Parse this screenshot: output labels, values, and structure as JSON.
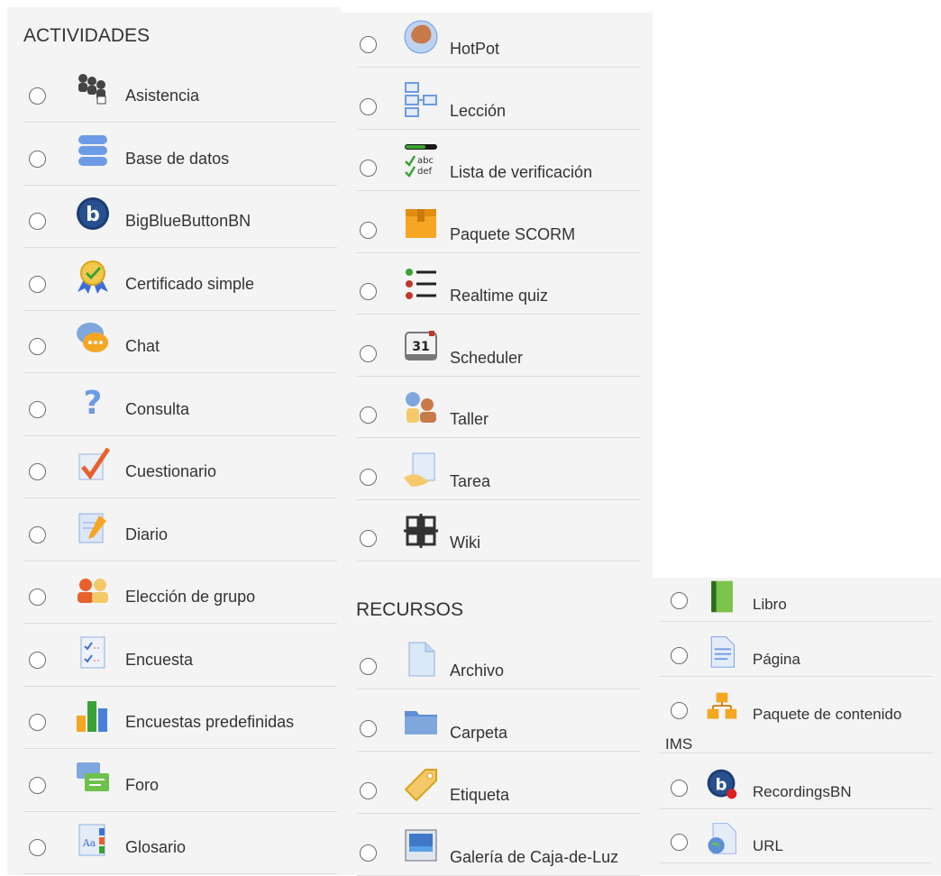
{
  "activities": {
    "heading": "ACTIVIDADES",
    "items": [
      {
        "label": "Asistencia",
        "icon": "attendance-icon"
      },
      {
        "label": "Base de datos",
        "icon": "database-icon"
      },
      {
        "label": "BigBlueButtonBN",
        "icon": "bigbluebutton-icon"
      },
      {
        "label": "Certificado simple",
        "icon": "certificate-icon"
      },
      {
        "label": "Chat",
        "icon": "chat-icon"
      },
      {
        "label": "Consulta",
        "icon": "question-icon"
      },
      {
        "label": "Cuestionario",
        "icon": "quiz-icon"
      },
      {
        "label": "Diario",
        "icon": "journal-icon"
      },
      {
        "label": "Elección de grupo",
        "icon": "group-choice-icon"
      },
      {
        "label": "Encuesta",
        "icon": "survey-icon"
      },
      {
        "label": "Encuestas predefinidas",
        "icon": "bar-chart-icon"
      },
      {
        "label": "Foro",
        "icon": "forum-icon"
      },
      {
        "label": "Glosario",
        "icon": "glossary-icon"
      }
    ],
    "more": [
      {
        "label": "HotPot",
        "icon": "hotpot-icon"
      },
      {
        "label": "Lección",
        "icon": "lesson-icon"
      },
      {
        "label": "Lista de verificación",
        "icon": "checklist-icon"
      },
      {
        "label": "Paquete SCORM",
        "icon": "scorm-package-icon"
      },
      {
        "label": "Realtime quiz",
        "icon": "realtime-quiz-icon"
      },
      {
        "label": "Scheduler",
        "icon": "calendar-icon"
      },
      {
        "label": "Taller",
        "icon": "workshop-icon"
      },
      {
        "label": "Tarea",
        "icon": "assignment-icon"
      },
      {
        "label": "Wiki",
        "icon": "wiki-icon"
      }
    ]
  },
  "resources": {
    "heading": "RECURSOS",
    "items": [
      {
        "label": "Archivo",
        "icon": "file-icon"
      },
      {
        "label": "Carpeta",
        "icon": "folder-icon"
      },
      {
        "label": "Etiqueta",
        "icon": "tag-icon"
      },
      {
        "label": "Galería de Caja-de-Luz",
        "icon": "lightbox-gallery-icon"
      }
    ],
    "more": [
      {
        "label": "Libro",
        "icon": "book-icon"
      },
      {
        "label": "Página",
        "icon": "page-icon"
      },
      {
        "label": "Paquete de contenido",
        "label_continued": "IMS",
        "icon": "ims-package-icon"
      },
      {
        "label": "RecordingsBN",
        "icon": "recordings-icon"
      },
      {
        "label": "URL",
        "icon": "url-icon"
      }
    ]
  },
  "colors": {
    "panel_bg": "#f4f4f4",
    "divider": "#dcdcdc",
    "text": "#333333",
    "icon_blue": "#5b8fd6",
    "icon_orange": "#f5a623"
  }
}
